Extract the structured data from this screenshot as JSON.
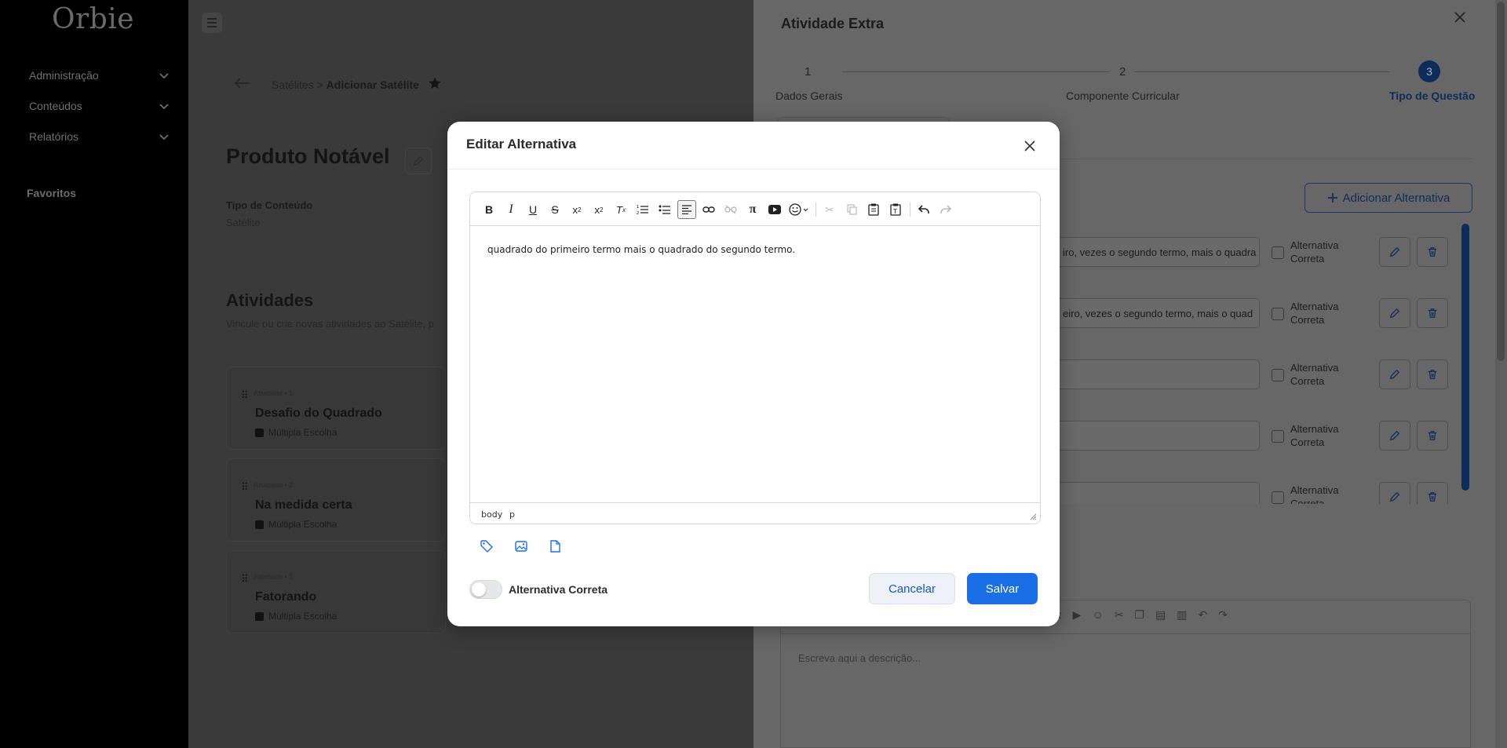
{
  "app": {
    "logo": "Orbie"
  },
  "sidebar": {
    "items": [
      {
        "label": "Administração"
      },
      {
        "label": "Conteúdos"
      },
      {
        "label": "Relatórios"
      }
    ],
    "favorites_label": "Favoritos"
  },
  "main": {
    "breadcrumb": {
      "parent": "Satélites",
      "separator": ">",
      "current": "Adicionar Satélite"
    },
    "title": "Produto Notável",
    "content_type_label": "Tipo de Conteúdo",
    "content_type_value": "Satélite",
    "activities_title": "Atividades",
    "activities_desc": "Vincule ou crie novas atividades ao Satélite, p",
    "activities": [
      {
        "kicker": "Atividade • 1",
        "name": "Desafio do Quadrado",
        "type": "Múltipla Escolha"
      },
      {
        "kicker": "Atividade • 2",
        "name": "Na medida certa",
        "type": "Múltipla Escolha"
      },
      {
        "kicker": "Atividade • 3",
        "name": "Fatorando",
        "type": "Múltipla Escolha"
      }
    ]
  },
  "drawer": {
    "title": "Atividade Extra",
    "steps": [
      {
        "num": "1",
        "label": "Dados Gerais"
      },
      {
        "num": "2",
        "label": "Componente Curricular"
      },
      {
        "num": "3",
        "label": "Tipo de Questão"
      }
    ],
    "add_alternative_label": "Adicionar Alternativa",
    "alternatives": [
      {
        "text": "iro, vezes o segundo termo, mais o quadra",
        "label": "Alternativa Correta"
      },
      {
        "text": "eiro, vezes o segundo termo, mais o quad",
        "label": "Alternativa Correta"
      },
      {
        "text": "",
        "label": "Alternativa Correta"
      },
      {
        "text": "",
        "label": "Alternativa Correta"
      },
      {
        "text": "",
        "label": "Alternativa Correta"
      }
    ],
    "description_placeholder": "Escreva aqui a descrição..."
  },
  "modal": {
    "title": "Editar Alternativa",
    "editor_content": "quadrado do primeiro termo mais o quadrado do segundo termo.",
    "status_path": [
      "body",
      "p"
    ],
    "correct_toggle_label": "Alternativa Correta",
    "correct_toggle_on": false,
    "cancel_label": "Cancelar",
    "save_label": "Salvar",
    "colors": {
      "primary": "#1a6ee6",
      "cancel_bg": "#eef2f8"
    }
  }
}
